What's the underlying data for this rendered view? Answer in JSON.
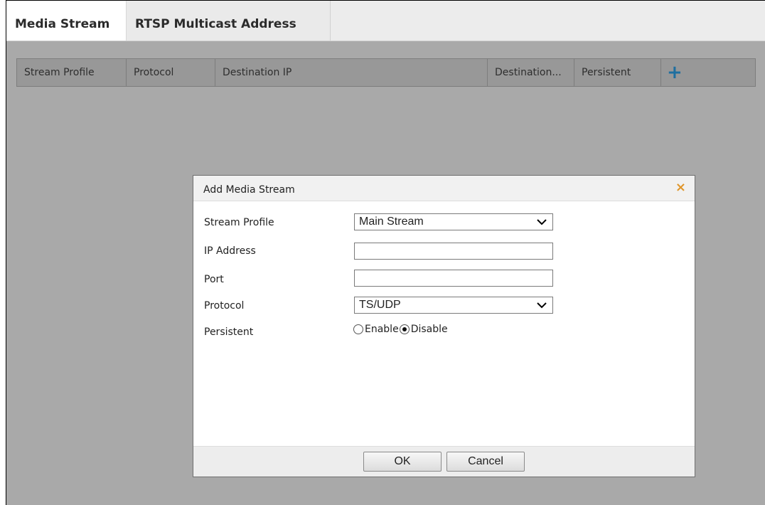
{
  "tabs": [
    {
      "label": "Media Stream",
      "active": true
    },
    {
      "label": "RTSP Multicast Address",
      "active": false
    }
  ],
  "table": {
    "columns": [
      "Stream Profile",
      "Protocol",
      "Destination IP",
      "Destination...",
      "Persistent"
    ],
    "add_icon": "+"
  },
  "dialog": {
    "title": "Add Media Stream",
    "close_icon": "×",
    "fields": {
      "stream_profile": {
        "label": "Stream Profile",
        "value": "Main Stream"
      },
      "ip_address": {
        "label": "IP Address",
        "value": ""
      },
      "port": {
        "label": "Port",
        "value": ""
      },
      "protocol": {
        "label": "Protocol",
        "value": "TS/UDP"
      },
      "persistent": {
        "label": "Persistent",
        "enable": "Enable",
        "disable": "Disable",
        "selected": "Disable"
      }
    },
    "ok_label": "OK",
    "cancel_label": "Cancel"
  },
  "colors": {
    "overlay": "#a9a9a9",
    "accent_plus": "#1f6fa0",
    "close": "#e0962b"
  }
}
